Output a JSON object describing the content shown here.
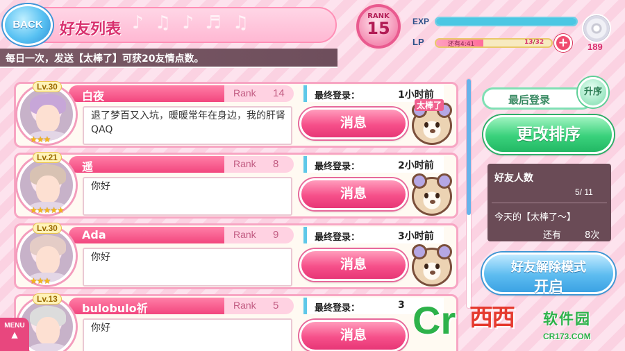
{
  "header": {
    "back_label": "BACK",
    "title": "好友列表",
    "notice": "每日一次，发送【太棒了】可获20友情点数。"
  },
  "status": {
    "rank_label": "RANK",
    "rank_value": "15",
    "exp_label": "EXP",
    "exp_fill_percent": 100,
    "lp_label": "LP",
    "lp_time": "还有4:41",
    "lp_current": "13",
    "lp_max": "32",
    "lp_fill_fraction": 0.41,
    "disc_count": "189"
  },
  "friends": [
    {
      "level": "Lv.30",
      "name": "白夜",
      "rank_label": "Rank",
      "rank": "14",
      "login_label": "最终登录：",
      "last_login": "1小时前",
      "message": "退了梦百又入坑，暖暖常年在身边，我的肝肾QAQ",
      "button": "消息",
      "bear_label": "太棒了",
      "stars": 3,
      "hair_color": "#c7a6d8"
    },
    {
      "level": "Lv.21",
      "name": "遥",
      "rank_label": "Rank",
      "rank": "8",
      "login_label": "最终登录：",
      "last_login": "2小时前",
      "message": "你好",
      "button": "消息",
      "bear_label": "",
      "stars": 5,
      "hair_color": "#d8c2b3"
    },
    {
      "level": "Lv.30",
      "name": "Ada",
      "rank_label": "Rank",
      "rank": "9",
      "login_label": "最终登录：",
      "last_login": "3小时前",
      "message": "你好",
      "button": "消息",
      "bear_label": "",
      "stars": 3,
      "hair_color": "#e4ccc6"
    },
    {
      "level": "Lv.13",
      "name": "bulobulo祈",
      "rank_label": "Rank",
      "rank": "5",
      "login_label": "最终登录：",
      "last_login": "3",
      "message": "你好",
      "button": "消息",
      "bear_label": "",
      "stars": 3,
      "hair_color": "#dcdcdc"
    }
  ],
  "sidebar": {
    "sort_label": "最后登录",
    "order_label": "升序",
    "change_sort_label": "更改排序",
    "friend_count_label": "好友人数",
    "friend_count_value": "5/ 11",
    "today_label": "今天的【太棒了～】",
    "remaining_label": "还有",
    "remaining_value": "8次",
    "unfriend_line1": "好友解除模式",
    "unfriend_line2": "开启"
  },
  "menu": {
    "label": "MENU",
    "icon": "arrow-up-icon"
  },
  "watermark": {
    "logo": "Cr",
    "brand": "西西",
    "subtitle": "软件园",
    "url": "CR173.COM"
  },
  "colors": {
    "accent_pink": "#f2467e",
    "accent_green": "#39d17b",
    "accent_blue": "#5dbcf0"
  }
}
